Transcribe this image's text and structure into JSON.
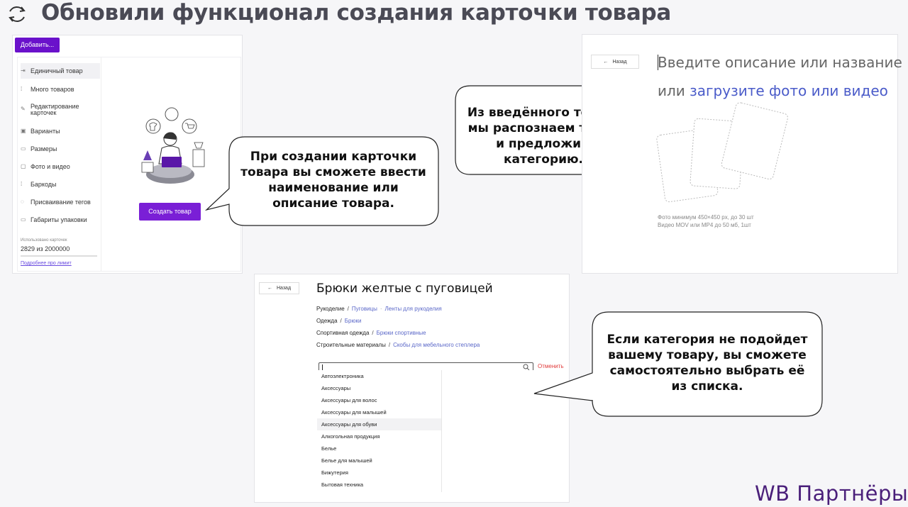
{
  "header": {
    "title": "Обновили функционал создания карточки товара"
  },
  "panel1": {
    "add_button": "Добавить...",
    "sidebar": [
      {
        "icon": "arrow-in-icon",
        "glyph": "⇥",
        "label": "Единичный товар"
      },
      {
        "icon": "grid-icon",
        "glyph": "⁞",
        "label": "Много товаров"
      },
      {
        "icon": "pencil-icon",
        "glyph": "✎",
        "label": "Редактирование карточек"
      },
      {
        "icon": "variants-icon",
        "glyph": "▣",
        "label": "Варианты"
      },
      {
        "icon": "ruler-icon",
        "glyph": "▭",
        "label": "Размеры"
      },
      {
        "icon": "image-icon",
        "glyph": "▢",
        "label": "Фото и видео"
      },
      {
        "icon": "barcode-icon",
        "glyph": "⁞",
        "label": "Баркоды"
      },
      {
        "icon": "tag-icon",
        "glyph": "◌",
        "label": "Присваивание тегов"
      },
      {
        "icon": "box-icon",
        "glyph": "▭",
        "label": "Габариты упаковки"
      }
    ],
    "usage_label": "Использовано карточек",
    "usage_value": "2829 из 2000000",
    "usage_link": "Подробнее про лимит",
    "create_button": "Создать товар"
  },
  "bubbles": {
    "b1": "При создании карточки товара вы сможете ввести наименование или описание товара.",
    "b2": "Из введённого текста мы распознаем товар и предложим категорию.",
    "b3": "Если категория не подойдет вашему товару, вы сможете самостоятельно выбрать её из списка."
  },
  "panel2": {
    "back": "Назад",
    "prompt_line1": "Введите описание или название",
    "prompt_line2_prefix": "или ",
    "prompt_line2_link": "загрузите фото или видео",
    "hint1": "Фото минимум 450×450 px, до 30 шт",
    "hint2": "Видео MOV или MP4 до 50 мб, 1шт"
  },
  "panel3": {
    "back": "Назад",
    "title": "Брюки желтые с пуговицей",
    "crumbs": [
      {
        "root": "Рукоделие",
        "leaf": "Пуговицы",
        "extra": "Ленты для рукоделия"
      },
      {
        "root": "Одежда",
        "leaf": "Брюки",
        "extra": ""
      },
      {
        "root": "Спортивная одежда",
        "leaf": "Брюки спортивные",
        "extra": ""
      },
      {
        "root": "Строительные материалы",
        "leaf": "Скобы для мебельного степлера",
        "extra": ""
      }
    ],
    "cancel": "Отменить",
    "options": [
      "Автоэлектроника",
      "Аксессуары",
      "Аксессуары для волос",
      "Аксессуары для малышей",
      "Аксессуары для обуви",
      "Алкогольная продукция",
      "Белье",
      "Белье для малышей",
      "Бижутерия",
      "Бытовая техника"
    ],
    "hover_index": 4
  },
  "brand": "WB Партнёры",
  "colors": {
    "accent": "#6a11cb",
    "link": "#4a5bc9",
    "danger": "#e03a3a",
    "brand": "#4a1f7a"
  }
}
